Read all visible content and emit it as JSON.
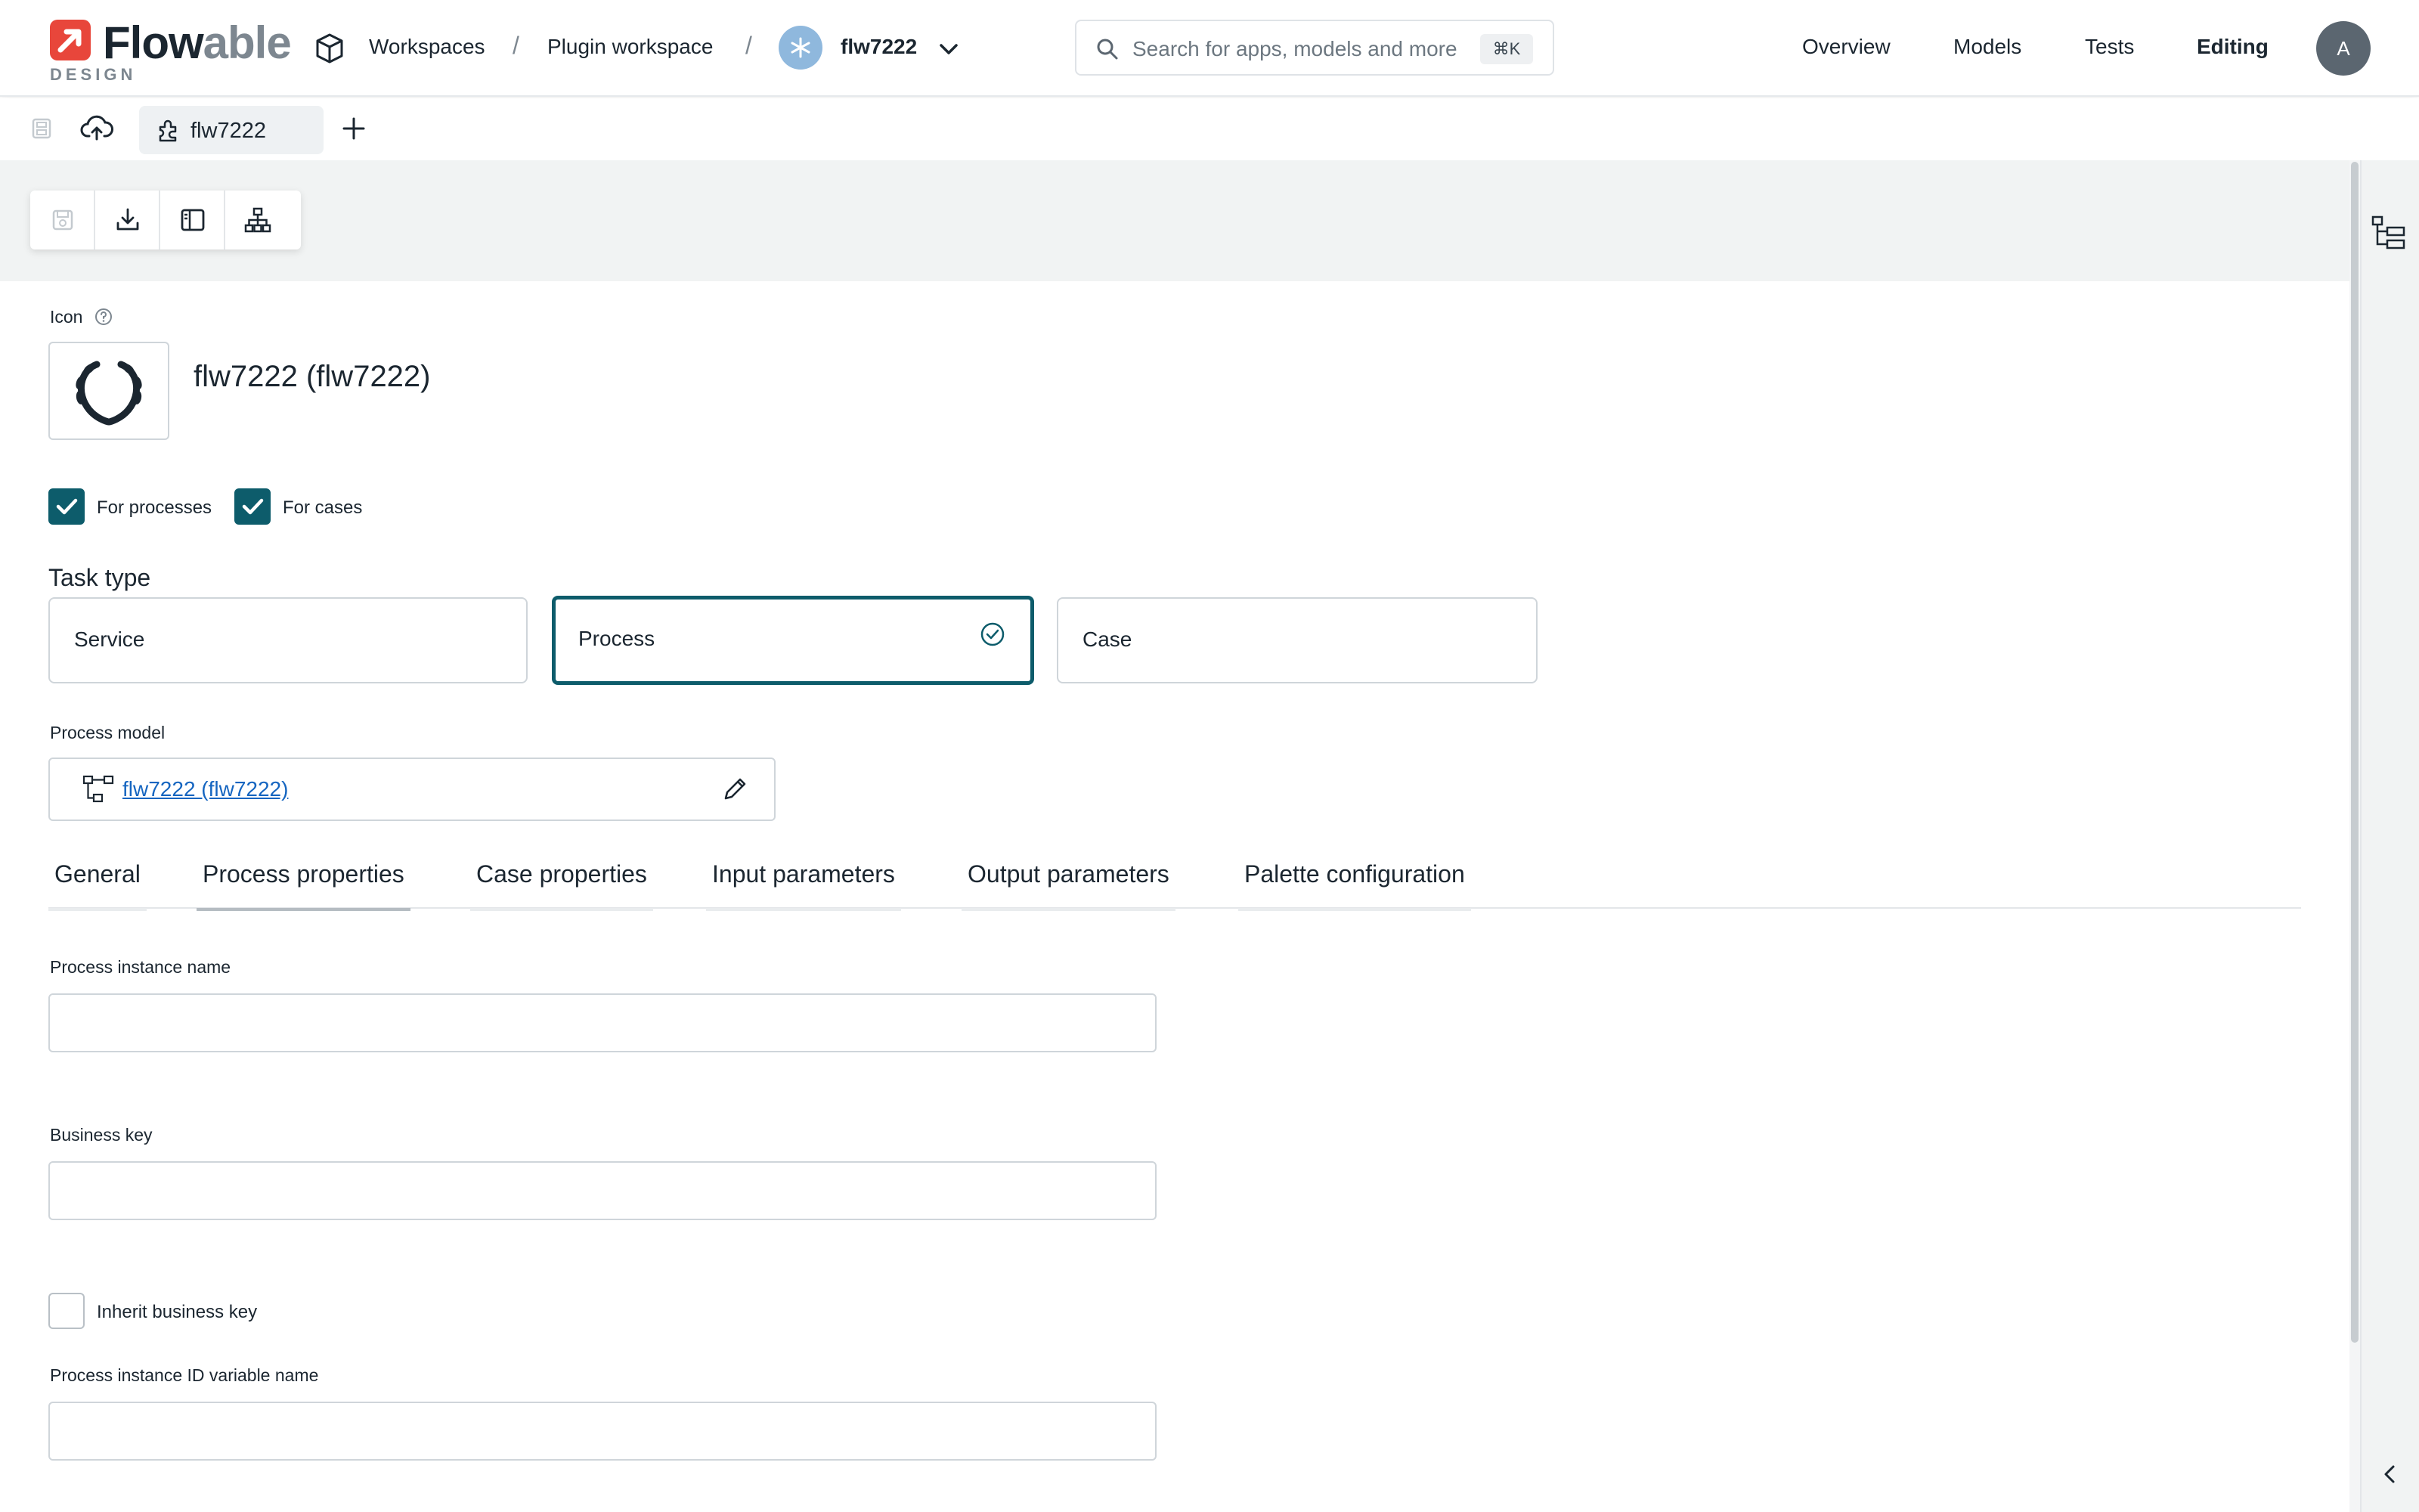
{
  "header": {
    "logo_word_main": "Flow",
    "logo_word_light": "able",
    "logo_sub": "DESIGN",
    "breadcrumb": {
      "workspaces": "Workspaces",
      "sep1": "/",
      "workspace": "Plugin workspace",
      "sep2": "/",
      "app": "flw7222"
    },
    "search": {
      "placeholder": "Search for apps, models and more",
      "shortcut": "⌘K"
    },
    "nav": {
      "overview": "Overview",
      "models": "Models",
      "tests": "Tests",
      "editing": "Editing"
    },
    "avatar_initial": "A"
  },
  "tabbar": {
    "file_tab": "flw7222"
  },
  "form": {
    "icon_label": "Icon",
    "title": "flw7222 (flw7222)",
    "for_processes": {
      "label": "For processes",
      "checked": true
    },
    "for_cases": {
      "label": "For cases",
      "checked": true
    },
    "task_type_label": "Task type",
    "task_types": [
      {
        "label": "Service",
        "selected": false
      },
      {
        "label": "Process",
        "selected": true
      },
      {
        "label": "Case",
        "selected": false
      }
    ],
    "process_model_label": "Process model",
    "process_model_value": "flw7222 (flw7222)",
    "tabs": [
      "General",
      "Process properties",
      "Case properties",
      "Input parameters",
      "Output parameters",
      "Palette configuration"
    ],
    "active_tab": "Process properties",
    "process_instance_name_label": "Process instance name",
    "business_key_label": "Business key",
    "inherit_business_key": {
      "label": "Inherit business key",
      "checked": false
    },
    "process_instance_id_label": "Process instance ID variable name"
  },
  "colors": {
    "accent": "#0d5c6b",
    "brand_red": "#e8463b",
    "link": "#1565c0"
  }
}
